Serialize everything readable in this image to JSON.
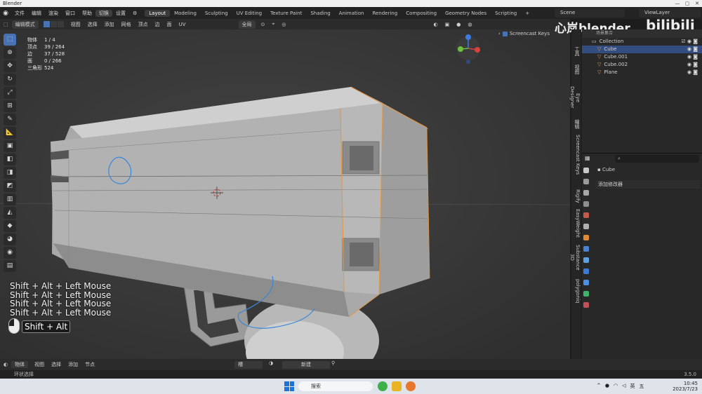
{
  "window": {
    "title": "Blender",
    "controls": [
      "—",
      "▢",
      "✕"
    ]
  },
  "menubar": {
    "menus": [
      "文件",
      "编辑",
      "渲染",
      "窗口",
      "帮助"
    ],
    "active_menu": "切换",
    "extra_menu": "设置",
    "workspaces": [
      "Layout",
      "Modeling",
      "Sculpting",
      "UV Editing",
      "Texture Paint",
      "Shading",
      "Animation",
      "Rendering",
      "Compositing",
      "Geometry Nodes",
      "Scripting"
    ],
    "active_workspace": "Layout",
    "add_tab": "+",
    "scene": "Scene",
    "view_layer": "ViewLayer"
  },
  "viewport_header": {
    "mode": "编辑模式",
    "items": [
      "视图",
      "选择",
      "添加",
      "网格",
      "顶点",
      "边",
      "面",
      "UV"
    ],
    "transform_space": "全局"
  },
  "stats": [
    {
      "label": "物体",
      "value": "1 / 4"
    },
    {
      "label": "顶点",
      "value": "39 / 264"
    },
    {
      "label": "边",
      "value": "37 / 528"
    },
    {
      "label": "面",
      "value": "0 / 266"
    },
    {
      "label": "三角形",
      "value": "524"
    }
  ],
  "screencast": {
    "label": "Screencast Keys",
    "lines": [
      "Shift + Alt + Left Mouse",
      "Shift + Alt + Left Mouse",
      "Shift + Alt + Left Mouse",
      "Shift + Alt + Left Mouse"
    ],
    "current": "Shift + Alt"
  },
  "watermark": {
    "text": "心岚blender",
    "brand": "bilibili"
  },
  "tools": [
    "select-box",
    "cursor",
    "move",
    "rotate",
    "scale",
    "transform",
    "annotate",
    "measure",
    "add-cube",
    "extrude",
    "inset",
    "bevel",
    "loop-cut",
    "knife",
    "poly-build",
    "spin",
    "smooth",
    "shrink",
    "shear",
    "rip"
  ],
  "sidebar_tabs": [
    "工具",
    "视图",
    "Eye Designer",
    "编辑",
    "Screencast Keys",
    "Rigify",
    "EasyWeight",
    "Substance 3D",
    "polygoniq"
  ],
  "outliner": {
    "header": "场景集合",
    "collection": "Collection",
    "objects": [
      {
        "name": "Cube",
        "selected": true
      },
      {
        "name": "Cube.001",
        "selected": false
      },
      {
        "name": "Cube.002",
        "selected": false
      },
      {
        "name": "Plane",
        "selected": false
      }
    ]
  },
  "properties": {
    "object_name": "Cube",
    "add_modifier": "添加修改器"
  },
  "timeline": {
    "mode": "物体",
    "items": [
      "视图",
      "选择",
      "添加",
      "节点"
    ],
    "slot": "槽",
    "new_button": "新建"
  },
  "statusbar": {
    "hint": "环状选择",
    "version": "3.5.0"
  },
  "taskbar": {
    "search": "搜索",
    "tray": [
      "英",
      "五"
    ],
    "time": "10:45",
    "date": "2023/7/23"
  }
}
